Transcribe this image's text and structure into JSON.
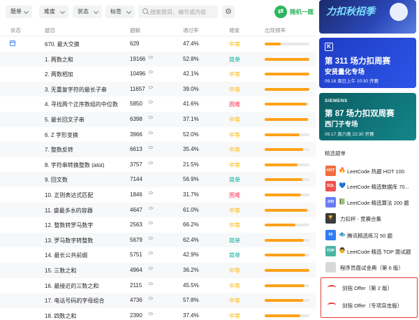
{
  "filters": {
    "list_label": "题单",
    "difficulty_label": "难度",
    "status_label": "状态",
    "tags_label": "标签",
    "search_placeholder": "搜索题目、编号或内容",
    "random_label": "随机一题",
    "gear_glyph": "⚙",
    "shuffle_glyph": "⇄"
  },
  "table": {
    "headers": {
      "status": "状态",
      "title": "题目",
      "solution": "题解",
      "rate": "通过率",
      "difficulty": "难度",
      "frequency": "出现频率"
    },
    "rows": [
      {
        "title": "670. 最大交换",
        "solutions": "629",
        "rate": "47.4%",
        "difficulty": "中等",
        "level": "mid",
        "freq": 0.36,
        "status_icon": "calendar-icon",
        "video": false
      },
      {
        "title": "1. 两数之和",
        "solutions": "19166",
        "rate": "52.8%",
        "difficulty": "简单",
        "level": "easy",
        "freq": 1.0,
        "video": true
      },
      {
        "title": "2. 两数相加",
        "solutions": "10496",
        "rate": "42.1%",
        "difficulty": "中等",
        "level": "mid",
        "freq": 1.0,
        "video": true
      },
      {
        "title": "3. 无重复字符的最长子串",
        "solutions": "11657",
        "rate": "39.0%",
        "difficulty": "中等",
        "level": "mid",
        "freq": 1.0,
        "video": true
      },
      {
        "title": "4. 寻找两个正序数组的中位数",
        "solutions": "5850",
        "rate": "41.6%",
        "difficulty": "困难",
        "level": "hard",
        "freq": 0.93,
        "video": true
      },
      {
        "title": "5. 最长回文子串",
        "solutions": "6398",
        "rate": "37.1%",
        "difficulty": "中等",
        "level": "mid",
        "freq": 0.97,
        "video": true
      },
      {
        "title": "6. Z 字形变换",
        "solutions": "3966",
        "rate": "52.0%",
        "difficulty": "中等",
        "level": "mid",
        "freq": 0.78,
        "video": true
      },
      {
        "title": "7. 整数反转",
        "solutions": "6613",
        "rate": "35.4%",
        "difficulty": "中等",
        "level": "mid",
        "freq": 0.86,
        "video": true
      },
      {
        "title": "8. 字符串转换整数 (atoi)",
        "solutions": "3757",
        "rate": "21.5%",
        "difficulty": "中等",
        "level": "mid",
        "freq": 0.73,
        "video": true
      },
      {
        "title": "9. 回文数",
        "solutions": "7144",
        "rate": "56.9%",
        "difficulty": "简单",
        "level": "easy",
        "freq": 0.84,
        "video": false
      },
      {
        "title": "10. 正则表达式匹配",
        "solutions": "1846",
        "rate": "31.7%",
        "difficulty": "困难",
        "level": "hard",
        "freq": 0.82,
        "video": true
      },
      {
        "title": "11. 盛最多水的容器",
        "solutions": "4647",
        "rate": "61.0%",
        "difficulty": "中等",
        "level": "mid",
        "freq": 0.95,
        "video": true
      },
      {
        "title": "12. 整数转罗马数字",
        "solutions": "2563",
        "rate": "66.2%",
        "difficulty": "中等",
        "level": "mid",
        "freq": 0.69,
        "video": true
      },
      {
        "title": "13. 罗马数字转整数",
        "solutions": "5679",
        "rate": "62.4%",
        "difficulty": "简单",
        "level": "easy",
        "freq": 0.88,
        "video": true
      },
      {
        "title": "14. 最长公共前缀",
        "solutions": "5751",
        "rate": "42.9%",
        "difficulty": "简单",
        "level": "easy",
        "freq": 0.91,
        "video": true
      },
      {
        "title": "15. 三数之和",
        "solutions": "4964",
        "rate": "36.2%",
        "difficulty": "中等",
        "level": "mid",
        "freq": 1.0,
        "video": true
      },
      {
        "title": "16. 最接近的三数之和",
        "solutions": "2115",
        "rate": "45.5%",
        "difficulty": "中等",
        "level": "mid",
        "freq": 0.89,
        "video": true
      },
      {
        "title": "17. 电话号码的字母组合",
        "solutions": "4736",
        "rate": "57.8%",
        "difficulty": "中等",
        "level": "mid",
        "freq": 0.86,
        "video": true
      },
      {
        "title": "18. 四数之和",
        "solutions": "2390",
        "rate": "37.4%",
        "difficulty": "中等",
        "level": "mid",
        "freq": 0.8,
        "video": true
      }
    ]
  },
  "banners": {
    "top_title": "力扣秋招季",
    "weekly": {
      "logo": "K",
      "title": "第 311 场力扣周赛",
      "sub": "安贤量化专场",
      "time": "09.18 周日上午 10:30 开赛"
    },
    "biweekly": {
      "brand": "SIEMENS",
      "title": "第 87 场力扣双周赛",
      "sub": "西门子专场",
      "time": "09.17 周六晚 22:30 开赛"
    }
  },
  "problem_lists": {
    "title": "精选题单",
    "items": [
      {
        "icon_text": "HOT",
        "color": "#f36c3f",
        "emoji": "🔥",
        "name": "LeetCode 热题 HOT 100"
      },
      {
        "icon_text": "SQL",
        "color": "#f0504f",
        "emoji": "💙",
        "name": "LeetCode 精选数据库 70..."
      },
      {
        "icon_text": "200",
        "color": "#6a7cf5",
        "emoji": "📗",
        "name": "LeetCode 精选算法 200 题"
      },
      {
        "icon_text": "🏆",
        "color": "#3b3b3b",
        "emoji": "🏆",
        "name": "力扣杯 - 竞赛合集"
      },
      {
        "icon_text": "50",
        "color": "#2f7cf6",
        "emoji": "🐟",
        "name": "腾讯精选练习 50 题"
      },
      {
        "icon_text": "TOP",
        "color": "#4ab5a3",
        "emoji": "👨",
        "name": "LeetCode 精选 TOP 面试题"
      },
      {
        "icon_text": "",
        "color": "#d9d9d9",
        "emoji": "",
        "name": "程序员面试金典（第 6 版）"
      }
    ],
    "offers": [
      {
        "name": "剑指 Offer（第 2 版）"
      },
      {
        "name": "剑指 Offer（专项突击版）"
      }
    ]
  },
  "colors": {
    "accent": "#ffa116",
    "easy": "#00af9b",
    "medium": "#ffb800",
    "hard": "#ff2d55",
    "highlight_box": "#e53935"
  }
}
